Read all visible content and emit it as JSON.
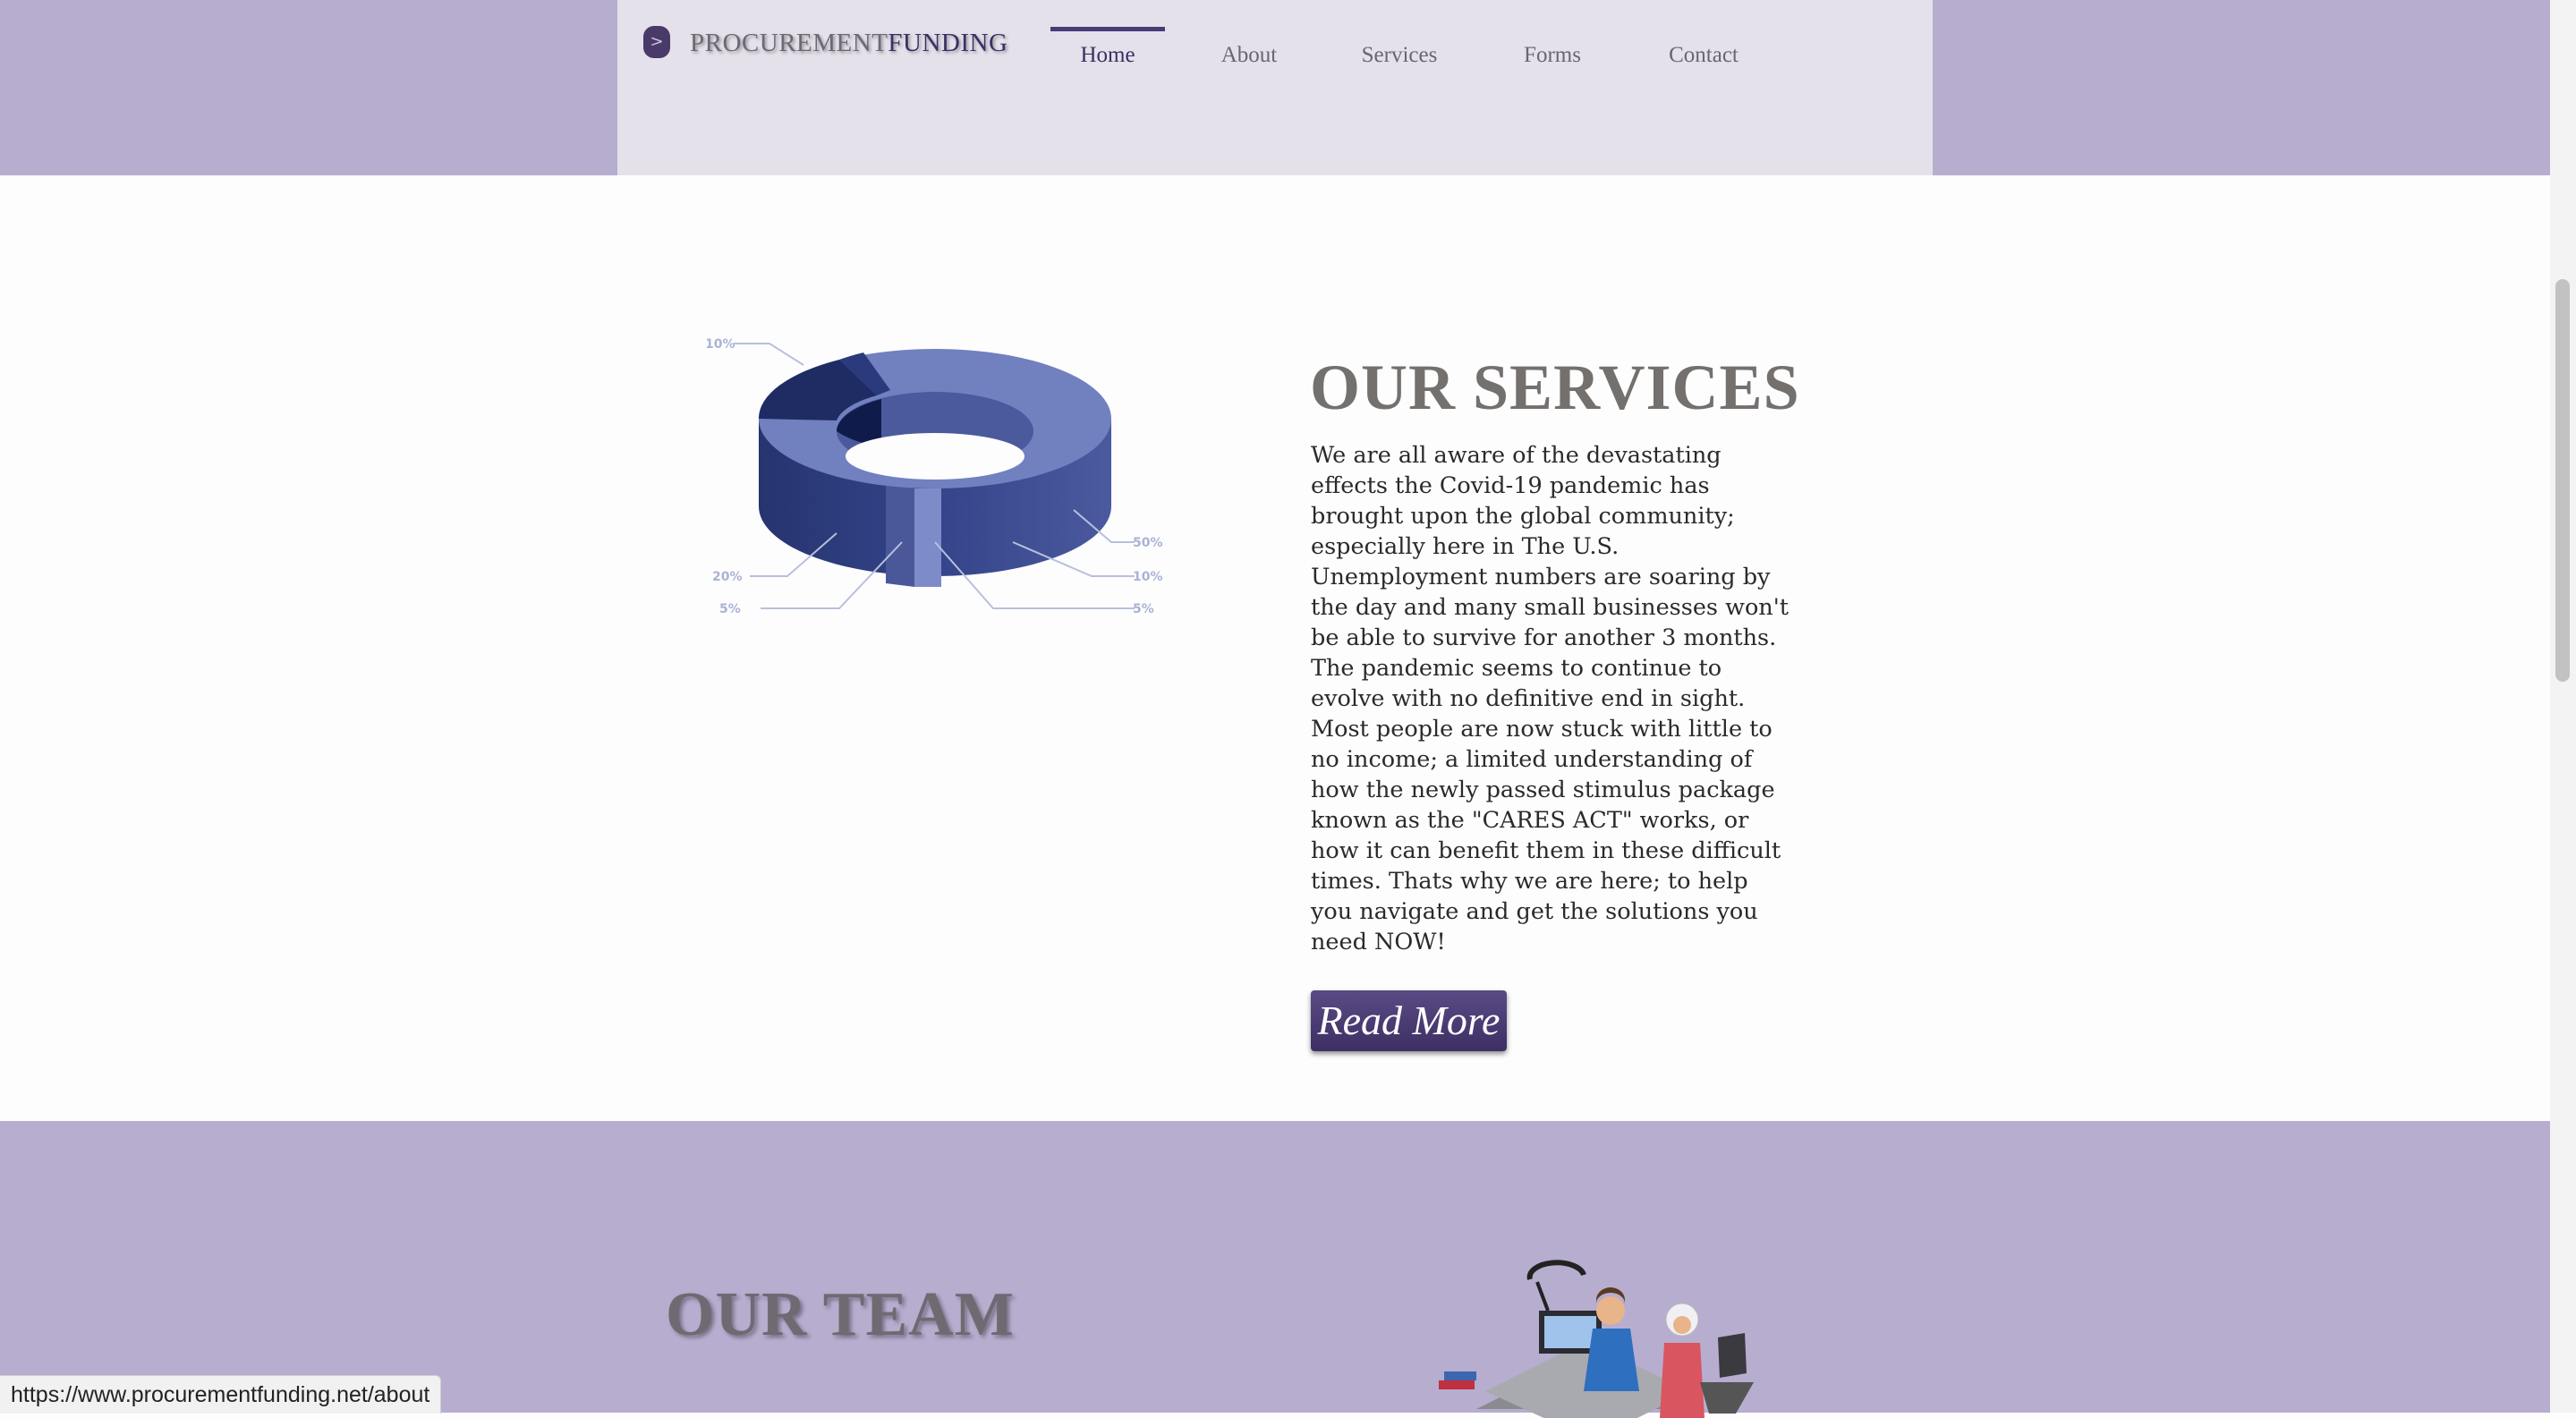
{
  "brand": {
    "icon": "chevron-right-icon",
    "icon_glyph": ">",
    "name_part1": "PROCUREMENT",
    "name_part2": "FUNDING"
  },
  "nav": {
    "items": [
      {
        "label": "Home",
        "active": true
      },
      {
        "label": "About",
        "active": false
      },
      {
        "label": "Services",
        "active": false
      },
      {
        "label": "Forms",
        "active": false
      },
      {
        "label": "Contact",
        "active": false
      }
    ]
  },
  "services": {
    "title": "OUR SERVICES",
    "body": "We are all aware of the devastating effects the Covid-19 pandemic has brought upon the global community; especially here in The U.S. Unemployment numbers are soaring by the day and many small businesses won't be able to survive for another 3 months. The pandemic seems to continue to evolve with no definitive end in sight. Most people are now stuck with little to no income; a limited understanding of how the newly passed stimulus package known as the \"CARES ACT\" works, or how it can benefit them in these difficult times. Thats why we are here; to help you navigate and get the solutions you need NOW!",
    "read_more_label": "Read More",
    "graphic_labels": {
      "top_left": "10%",
      "left_mid": "20%",
      "left_low": "5%",
      "right_top": "50%",
      "right_mid": "10%",
      "right_low": "5%"
    }
  },
  "team": {
    "title": "OUR TEAM"
  },
  "status_bar": {
    "url": "https://www.procurementfunding.net/about"
  },
  "colors": {
    "band": "#b7adcf",
    "header_inner": "#e4e1ea",
    "accent": "#3d2e66",
    "button": "#4a3b74"
  }
}
